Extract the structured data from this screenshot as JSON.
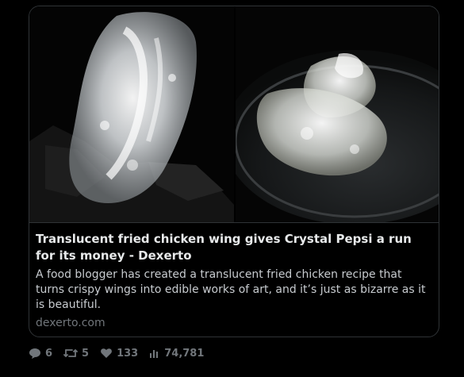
{
  "card": {
    "title": "Translucent fried chicken wing gives Crystal Pepsi a run for its money - Dexerto",
    "description": "A food blogger has created a translucent fried chicken recipe that turns crispy wings into edible works of art, and it’s just as bizarre as it is beautiful.",
    "domain": "dexerto.com"
  },
  "actions": {
    "replies": "6",
    "reposts": "5",
    "likes": "133",
    "views": "74,781"
  },
  "icons": {
    "replies": "comment-icon",
    "reposts": "repost-icon",
    "likes": "heart-icon",
    "views": "views-chart-icon"
  },
  "colors": {
    "background": "#000000",
    "border": "#2f3336",
    "title": "#e7e9ea",
    "muted": "#71767b"
  }
}
